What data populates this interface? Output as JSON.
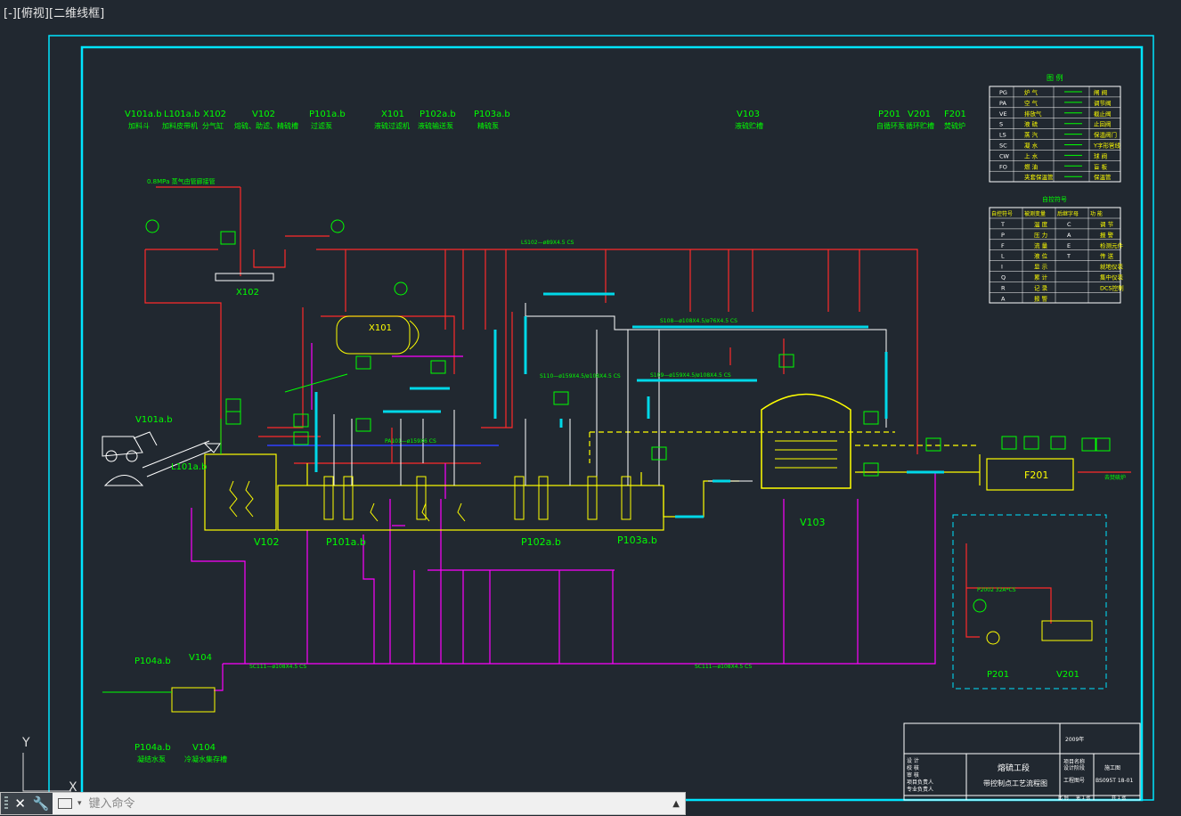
{
  "viewport": {
    "label_parts": [
      "[-]",
      "[俯视]",
      "[二维线框]"
    ]
  },
  "equipment_tags_top": [
    {
      "tag": "V101a.b",
      "desc": "加料斗"
    },
    {
      "tag": "L101a.b",
      "desc": "加料皮带机"
    },
    {
      "tag": "X102",
      "desc": "分气缸"
    },
    {
      "tag": "V102",
      "desc": "熔硫、助滤、精硫槽"
    },
    {
      "tag": "P101a.b",
      "desc": "过滤泵"
    },
    {
      "tag": "X101",
      "desc": "液硫过滤机"
    },
    {
      "tag": "P102a.b",
      "desc": "液硫输送泵"
    },
    {
      "tag": "P103a.b",
      "desc": "精硫泵"
    },
    {
      "tag": "V103",
      "desc": "液硫贮槽"
    },
    {
      "tag": "P201",
      "desc": "自循环泵"
    },
    {
      "tag": "V201",
      "desc": "循环贮槽"
    },
    {
      "tag": "F201",
      "desc": "焚硫炉"
    }
  ],
  "drawing_labels": {
    "steam_header": "0.8MPa 蒸气由管廊接管",
    "x102": "X102",
    "x101": "X101",
    "v101": "V101a.b",
    "l101": "L101a.b",
    "v102": "V102",
    "p101": "P101a.b",
    "p102": "P102a.b",
    "p103": "P103a.b",
    "v103": "V103",
    "f201": "F201",
    "p201": "P201",
    "v201": "V201",
    "p104_top": "P104a.b",
    "v104_top": "V104",
    "p104_bot": "P104a.b",
    "v104_bot": "V104",
    "p104_desc": "凝结水泵",
    "v104_desc": "冷凝水集存槽",
    "line_main_top": "LS102—ø89X4.5 CS",
    "line_bottom": "SC111—ø108X4.5 CS",
    "line_bottom2": "SC111—ø108X4.5 CS",
    "line_s108": "S108—ø108X4.5/ø76X4.5 CS",
    "line_s109": "S109—ø159X4.5/ø108X4.5 CS",
    "line_s110": "S110—ø159X4.5/ø108X4.5 CS",
    "line_p101": "PA101—ø159X6 CS",
    "line_p201": "P2002 32A*CS",
    "sulfur_out": "去焚硫炉"
  },
  "legend": {
    "title": "图 例",
    "rows": [
      [
        "PG",
        "炉 气",
        "闸 阀"
      ],
      [
        "PA",
        "空 气",
        "调节阀"
      ],
      [
        "VE",
        "排放气",
        "截止阀"
      ],
      [
        "S",
        "液 硫",
        "止回阀"
      ],
      [
        "LS",
        "蒸 汽",
        "保温阀门"
      ],
      [
        "SC",
        "凝 水",
        "Y字形管线"
      ],
      [
        "CW",
        "上 水",
        "球 阀"
      ],
      [
        "FO",
        "燃 油",
        "盲 板"
      ],
      [
        "",
        "夹套保温管",
        "保温管"
      ]
    ]
  },
  "instrument_legend": {
    "title": "自控符号",
    "header": [
      "自控符号",
      "被测变量",
      "后继字母",
      "功 能"
    ],
    "rows": [
      [
        "T",
        "温 度",
        "C",
        "调 节"
      ],
      [
        "P",
        "压 力",
        "A",
        "报 警"
      ],
      [
        "F",
        "流 量",
        "E",
        "检测元件"
      ],
      [
        "L",
        "液 位",
        "T",
        "传 送"
      ],
      [
        "I",
        "显 示",
        "",
        "就地仪表"
      ],
      [
        "Q",
        "累 计",
        "",
        "集中仪表"
      ],
      [
        "R",
        "记 录",
        "",
        "DCS控制"
      ],
      [
        "A",
        "报 警",
        "",
        ""
      ]
    ]
  },
  "title_block": {
    "year": "2009年",
    "company": "熔硫工段",
    "drawing_title": "带控制点工艺流程图",
    "project_label": "项目名称",
    "design_stage": "设计阶段",
    "stage_value": "施工图",
    "drawing_no_label": "工程图号",
    "drawing_no": "BS095T 18-01",
    "roles": [
      "设 计",
      "校 核",
      "审 核",
      "项目负责人",
      "专业负责人"
    ],
    "scale": "比 例",
    "sheet": "第 1 张",
    "total": "共 1 张"
  },
  "ucs": {
    "y": "Y",
    "x": "X"
  },
  "command_line": {
    "placeholder": "键入命令"
  },
  "colors": {
    "background": "#212830",
    "frame_cyan": "#00e5ff",
    "line_red": "#ff2a2a",
    "line_magenta": "#ff00ff",
    "line_green": "#00ff00",
    "line_yellow": "#ffff00",
    "line_cyan": "#00d8e8",
    "white": "#ffffff",
    "blue": "#3040ff"
  }
}
